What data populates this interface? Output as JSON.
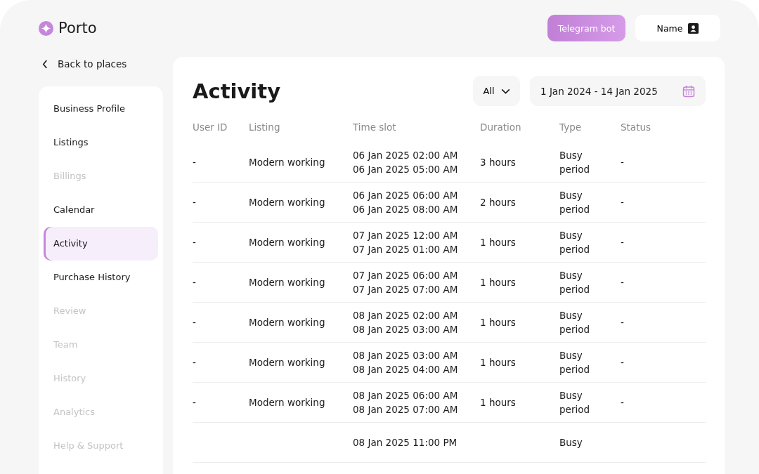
{
  "brand": {
    "name": "Porto"
  },
  "header": {
    "telegram_button": "Telegram bot",
    "profile_button": "Name"
  },
  "back_link": "Back to places",
  "sidebar": {
    "items": [
      {
        "label": "Business Profile",
        "selected": false,
        "disabled": false
      },
      {
        "label": "Listings",
        "selected": false,
        "disabled": false
      },
      {
        "label": "Billings",
        "selected": false,
        "disabled": true
      },
      {
        "label": "Calendar",
        "selected": false,
        "disabled": false
      },
      {
        "label": "Activity",
        "selected": true,
        "disabled": false
      },
      {
        "label": "Purchase History",
        "selected": false,
        "disabled": false
      },
      {
        "label": "Review",
        "selected": false,
        "disabled": true
      },
      {
        "label": "Team",
        "selected": false,
        "disabled": true
      },
      {
        "label": "History",
        "selected": false,
        "disabled": true
      },
      {
        "label": "Analytics",
        "selected": false,
        "disabled": true
      },
      {
        "label": "Help & Support",
        "selected": false,
        "disabled": true
      }
    ]
  },
  "page_title": "Activity",
  "filter": {
    "value": "All"
  },
  "date_range": {
    "value": "1 Jan 2024 - 14 Jan 2025"
  },
  "table": {
    "columns": [
      "User ID",
      "Listing",
      "Time slot",
      "Duration",
      "Type",
      "Status"
    ],
    "rows": [
      {
        "user_id": "-",
        "listing": "Modern working",
        "start": "06 Jan 2025 02:00 AM",
        "end": "06 Jan 2025 05:00 AM",
        "duration": "3 hours",
        "type": "Busy period",
        "status": "-"
      },
      {
        "user_id": "-",
        "listing": "Modern working",
        "start": "06 Jan 2025 06:00 AM",
        "end": "06 Jan 2025 08:00 AM",
        "duration": "2 hours",
        "type": "Busy period",
        "status": "-"
      },
      {
        "user_id": "-",
        "listing": "Modern working",
        "start": "07 Jan 2025 12:00 AM",
        "end": "07 Jan 2025 01:00 AM",
        "duration": "1 hours",
        "type": "Busy period",
        "status": "-"
      },
      {
        "user_id": "-",
        "listing": "Modern working",
        "start": "07 Jan 2025 06:00 AM",
        "end": "07 Jan 2025 07:00 AM",
        "duration": "1 hours",
        "type": "Busy period",
        "status": "-"
      },
      {
        "user_id": "-",
        "listing": "Modern working",
        "start": "08 Jan 2025 02:00 AM",
        "end": "08 Jan 2025 03:00 AM",
        "duration": "1 hours",
        "type": "Busy period",
        "status": "-"
      },
      {
        "user_id": "-",
        "listing": "Modern working",
        "start": "08 Jan 2025 03:00 AM",
        "end": "08 Jan 2025 04:00 AM",
        "duration": "1 hours",
        "type": "Busy period",
        "status": "-"
      },
      {
        "user_id": "-",
        "listing": "Modern working",
        "start": "08 Jan 2025 06:00 AM",
        "end": "08 Jan 2025 07:00 AM",
        "duration": "1 hours",
        "type": "Busy period",
        "status": "-"
      },
      {
        "start": "08 Jan 2025 11:00 PM",
        "type": "Busy"
      }
    ]
  }
}
